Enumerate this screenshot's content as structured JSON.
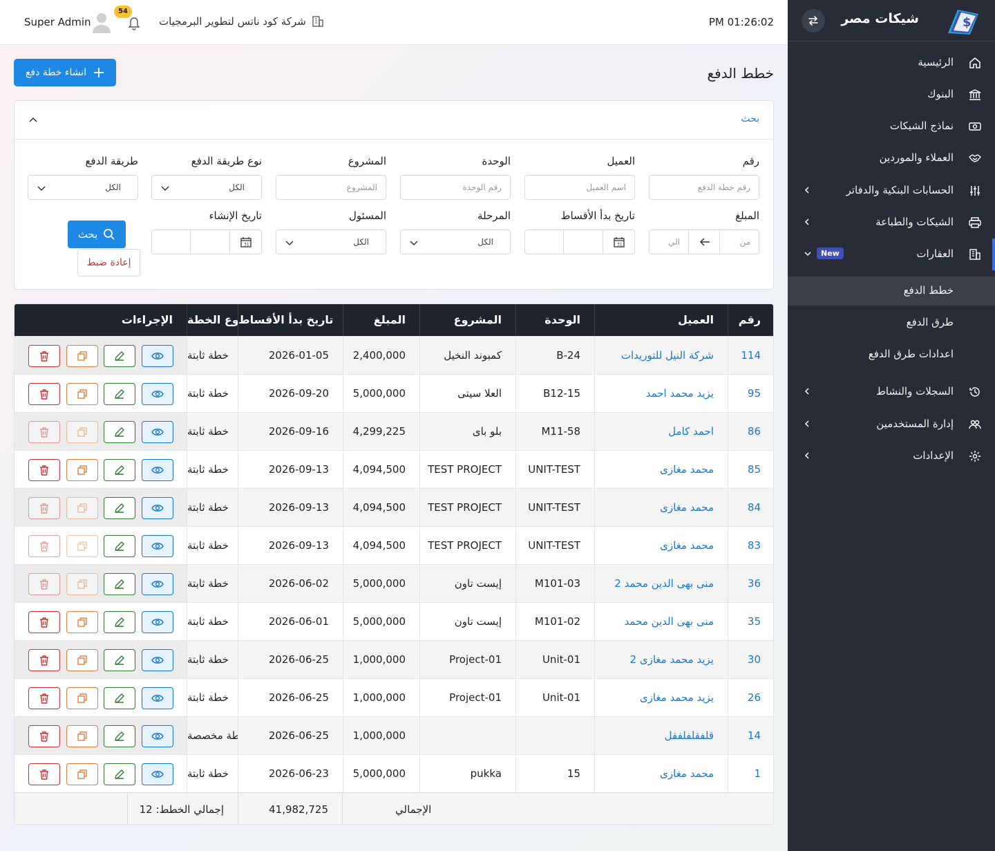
{
  "sidebar": {
    "brand": "شيكات مصر",
    "items": [
      {
        "label": "الرئيسية",
        "icon": "home-icon"
      },
      {
        "label": "البنوك",
        "icon": "bank-icon"
      },
      {
        "label": "نماذج الشيكات",
        "icon": "cash-icon"
      },
      {
        "label": "العملاء والموردين",
        "icon": "handshake-icon"
      },
      {
        "label": "الحسابات البنكية والدفاتر",
        "icon": "sliders-icon"
      },
      {
        "label": "الشيكات والطباعة",
        "icon": "printer-icon"
      },
      {
        "label": "العقارات",
        "icon": "building-icon",
        "badge": "New"
      },
      {
        "label": "السجلات والنشاط",
        "icon": "history-icon"
      },
      {
        "label": "إدارة المستخدمين",
        "icon": "users-icon"
      },
      {
        "label": "الإعدادات",
        "icon": "gear-icon"
      }
    ],
    "sub_items": [
      {
        "label": "خطط الدفع"
      },
      {
        "label": "طرق الدفع"
      },
      {
        "label": "اعدادات طرق الدفع"
      }
    ]
  },
  "topbar": {
    "time": "PM 01:26:02",
    "company": "شركة كود ناتس لتطوير البرمجيات",
    "notifications": "54",
    "user": "Super Admin"
  },
  "page": {
    "title": "خطط الدفع",
    "create_label": "انشاء خطة دفع"
  },
  "search": {
    "title": "بحث",
    "labels": {
      "number": "رقم",
      "client": "العميل",
      "unit": "الوحدة",
      "project": "المشروع",
      "method_type": "نوع طريقة الدفع",
      "method": "طريقة الدفع",
      "amount": "المبلغ",
      "start_date": "تاريخ بدأ الأقساط",
      "stage": "المرحلة",
      "owner": "المسئول",
      "created": "تاريخ الإنشاء"
    },
    "placeholders": {
      "number": "رقم خطة الدفع",
      "client": "اسم العميل",
      "unit": "رقم الوحدة",
      "project": "المشروع",
      "from": "من",
      "to": "الي"
    },
    "select_all": "الكل",
    "search_button": "بحث",
    "reset_button": "إعادة ضبط"
  },
  "table": {
    "headers": [
      "رقم",
      "العميل",
      "الوحدة",
      "المشروع",
      "المبلغ",
      "تاريخ بدأ الأقساط",
      "نوع الخطة",
      "الإجراءات"
    ],
    "rows": [
      {
        "id": "114",
        "client": "شركة النيل للتوريدات",
        "unit": "B-24",
        "project": "كمبوند النخيل",
        "amount": "2,400,000",
        "date": "2026-01-05",
        "type": "خطة ثابتة"
      },
      {
        "id": "95",
        "client": "يزيد محمد احمد",
        "unit": "B12-15",
        "project": "العلا سيتى",
        "amount": "5,000,000",
        "date": "2026-09-20",
        "type": "خطة ثابتة"
      },
      {
        "id": "86",
        "client": "احمد كامل",
        "unit": "M11-58",
        "project": "بلو باى",
        "amount": "4,299,225",
        "date": "2026-09-16",
        "type": "خطة ثابتة"
      },
      {
        "id": "85",
        "client": "محمد مغازى",
        "unit": "UNIT-TEST",
        "project": "TEST PROJECT",
        "amount": "4,094,500",
        "date": "2026-09-13",
        "type": "خطة ثابتة"
      },
      {
        "id": "84",
        "client": "محمد مغازى",
        "unit": "UNIT-TEST",
        "project": "TEST PROJECT",
        "amount": "4,094,500",
        "date": "2026-09-13",
        "type": "خطة ثابتة"
      },
      {
        "id": "83",
        "client": "محمد مغازى",
        "unit": "UNIT-TEST",
        "project": "TEST PROJECT",
        "amount": "4,094,500",
        "date": "2026-09-13",
        "type": "خطة ثابتة"
      },
      {
        "id": "36",
        "client": "منى بهى الدين محمد 2",
        "unit": "M101-03",
        "project": "إيست تاون",
        "amount": "5,000,000",
        "date": "2026-06-02",
        "type": "خطة ثابتة"
      },
      {
        "id": "35",
        "client": "منى بهى الدين محمد",
        "unit": "M101-02",
        "project": "إيست تاون",
        "amount": "5,000,000",
        "date": "2026-06-01",
        "type": "خطة ثابتة"
      },
      {
        "id": "30",
        "client": "يزيد محمد مغازى 2",
        "unit": "Unit-01",
        "project": "Project-01",
        "amount": "1,000,000",
        "date": "2026-06-25",
        "type": "خطة ثابتة"
      },
      {
        "id": "26",
        "client": "يزيد محمد مغازى",
        "unit": "Unit-01",
        "project": "Project-01",
        "amount": "1,000,000",
        "date": "2026-06-25",
        "type": "خطة ثابتة"
      },
      {
        "id": "14",
        "client": "قلفقلفلفقل",
        "unit": "",
        "project": "",
        "amount": "1,000,000",
        "date": "2026-06-25",
        "type": "خطة مخصصة"
      },
      {
        "id": "1",
        "client": "محمد مغازى",
        "unit": "15",
        "project": "pukka",
        "amount": "5,000,000",
        "date": "2026-06-23",
        "type": "خطة ثابتة"
      }
    ],
    "footer": {
      "total_label": "الإجمالي",
      "total_amount": "41,982,725",
      "count_label": "إجمالي الخطط: 12"
    }
  },
  "colors": {
    "sidebar": "#272c36",
    "primary": "#1e88e5",
    "table_header": "#1f232b",
    "link": "#1976d2",
    "danger": "#d32f2f",
    "success": "#2e7d32",
    "warning": "#e67e3a"
  }
}
